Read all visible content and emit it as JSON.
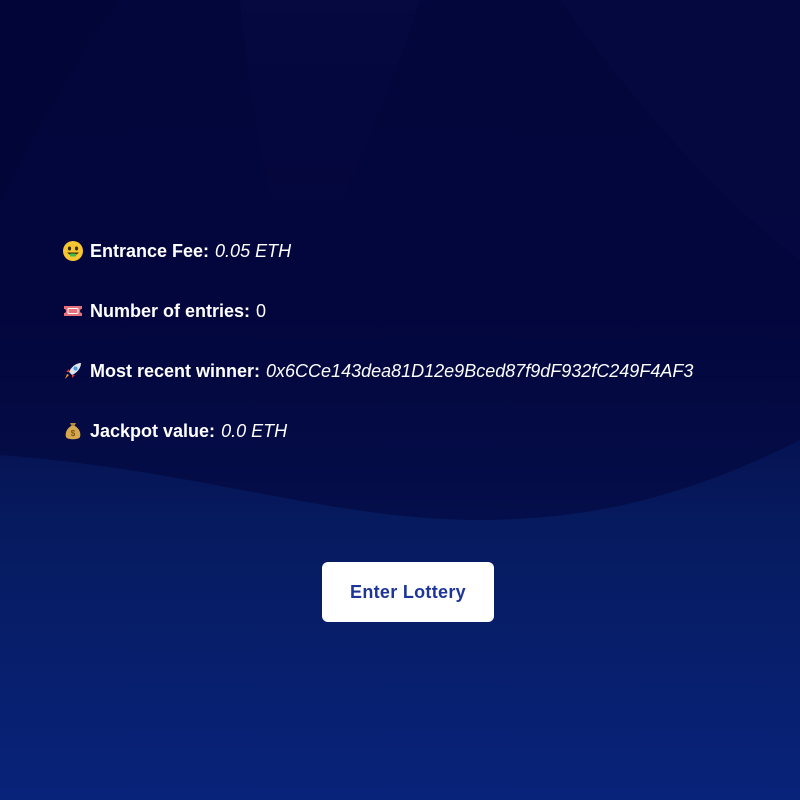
{
  "lottery": {
    "entrance_fee": {
      "icon": "money-mouth-face-icon",
      "label": "Entrance Fee:",
      "value": "0.05 ETH"
    },
    "entries": {
      "icon": "ticket-icon",
      "label": "Number of entries:",
      "value": "0"
    },
    "recent_winner": {
      "icon": "rocket-icon",
      "label": "Most recent winner:",
      "value": "0x6CCe143dea81D12e9Bced87f9dF932fC249F4AF3"
    },
    "jackpot": {
      "icon": "money-bag-icon",
      "label": "Jackpot value:",
      "value": "0.0 ETH"
    }
  },
  "actions": {
    "enter_label": "Enter Lottery"
  },
  "colors": {
    "background_top": "#04073a",
    "background_bottom": "#08237a",
    "button_background": "#ffffff",
    "button_text": "#1d3598"
  }
}
